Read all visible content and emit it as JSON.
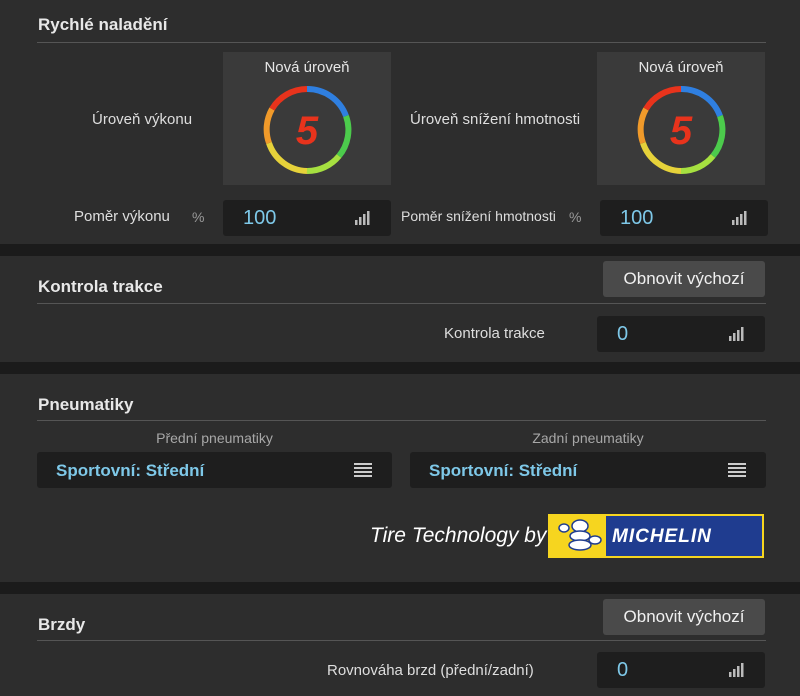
{
  "quick_tune": {
    "title": "Rychlé naladění",
    "power_level_label": "Úroveň výkonu",
    "weight_level_label": "Úroveň snížení hmotnosti",
    "new_level_caption": "Nová úroveň",
    "power_level_value": "5",
    "weight_level_value": "5",
    "power_ratio_label": "Poměr výkonu",
    "power_ratio_unit": "%",
    "power_ratio_value": "100",
    "weight_ratio_label": "Poměr snížení hmotnosti",
    "weight_ratio_unit": "%",
    "weight_ratio_value": "100"
  },
  "traction": {
    "title": "Kontrola trakce",
    "reset_label": "Obnovit výchozí",
    "control_label": "Kontrola trakce",
    "control_value": "0"
  },
  "tires": {
    "title": "Pneumatiky",
    "front_header": "Přední pneumatiky",
    "rear_header": "Zadní pneumatiky",
    "front_value": "Sportovní: Střední",
    "rear_value": "Sportovní: Střední",
    "tech_text": "Tire Technology by",
    "brand_logo_text": "MICHELIN"
  },
  "brakes": {
    "title": "Brzdy",
    "reset_label": "Obnovit výchozí",
    "balance_label": "Rovnováha brzd (přední/zadní)",
    "balance_value": "0"
  },
  "colors": {
    "accent_value": "#7ec8e8",
    "level_number": "#e8331c"
  },
  "icons": [
    "level-ring-icon",
    "signal-bars-icon",
    "menu-lines-icon",
    "michelin-logo"
  ]
}
